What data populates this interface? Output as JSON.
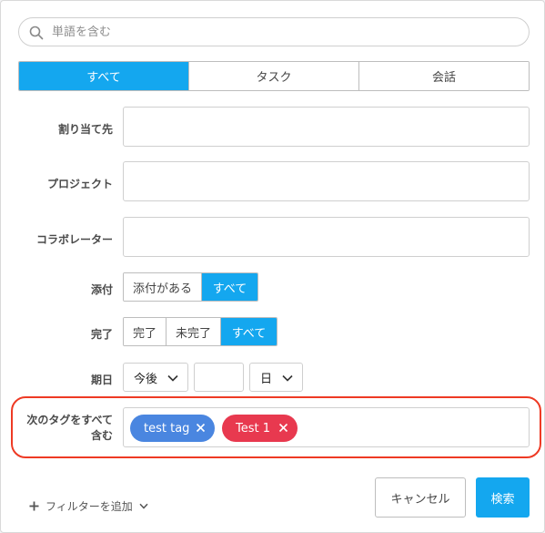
{
  "search": {
    "placeholder": "単語を含む",
    "value": ""
  },
  "tabs": [
    {
      "label": "すべて",
      "active": true
    },
    {
      "label": "タスク",
      "active": false
    },
    {
      "label": "会話",
      "active": false
    }
  ],
  "fields": {
    "assignee": {
      "label": "割り当て先",
      "value": ""
    },
    "project": {
      "label": "プロジェクト",
      "value": ""
    },
    "collaborator": {
      "label": "コラボレーター",
      "value": ""
    }
  },
  "attachment": {
    "label": "添付",
    "options": [
      {
        "label": "添付がある",
        "active": false
      },
      {
        "label": "すべて",
        "active": true
      }
    ]
  },
  "completion": {
    "label": "完了",
    "options": [
      {
        "label": "完了",
        "active": false
      },
      {
        "label": "未完了",
        "active": false
      },
      {
        "label": "すべて",
        "active": true
      }
    ]
  },
  "due": {
    "label": "期日",
    "relation": "今後",
    "amount": "",
    "unit": "日"
  },
  "tags": {
    "label_line1": "次のタグをすべて",
    "label_line2": "含む",
    "items": [
      {
        "label": "test tag",
        "color": "#4a86e0"
      },
      {
        "label": "Test 1",
        "color": "#e8394f"
      }
    ]
  },
  "footer": {
    "add_filter": "フィルターを追加",
    "cancel": "キャンセル",
    "search": "検索"
  },
  "colors": {
    "accent": "#14a7ef",
    "highlight": "#ee3a24"
  },
  "icons": {
    "search": "search-icon",
    "plus": "plus-icon",
    "chevron": "chevron-down-icon",
    "close": "close-icon"
  }
}
